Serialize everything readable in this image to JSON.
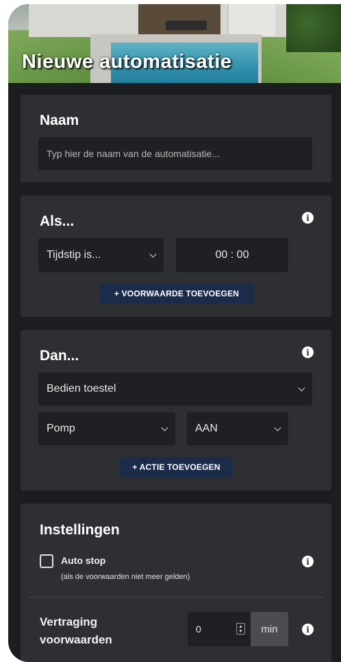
{
  "header": {
    "title": "Nieuwe automatisatie"
  },
  "name_section": {
    "title": "Naam",
    "placeholder": "Typ hier de naam van de automatisatie..."
  },
  "if_section": {
    "title": "Als...",
    "condition_select": "Tijdstip is...",
    "time_value": "00 : 00",
    "add_condition_label": "+ VOORWAARDE TOEVOEGEN"
  },
  "then_section": {
    "title": "Dan...",
    "action_select": "Bedien toestel",
    "device_select": "Pomp",
    "state_select": "AAN",
    "add_action_label": "+ ACTIE TOEVOEGEN"
  },
  "settings_section": {
    "title": "Instellingen",
    "auto_stop_label": "Auto stop",
    "auto_stop_hint": "(als de voorwaarden niet meer gelden)",
    "auto_stop_checked": false,
    "delay_label_line1": "Vertraging",
    "delay_label_line2": "voorwaarden",
    "delay_value": "0",
    "delay_unit": "min"
  },
  "icons": {
    "info": "info-icon",
    "chevron": "chevron-down-icon",
    "stepper": "stepper-icon"
  },
  "colors": {
    "background": "#1c1d20",
    "card": "#2d2f33",
    "field": "#1f2023",
    "button": "#1b2c4a"
  }
}
